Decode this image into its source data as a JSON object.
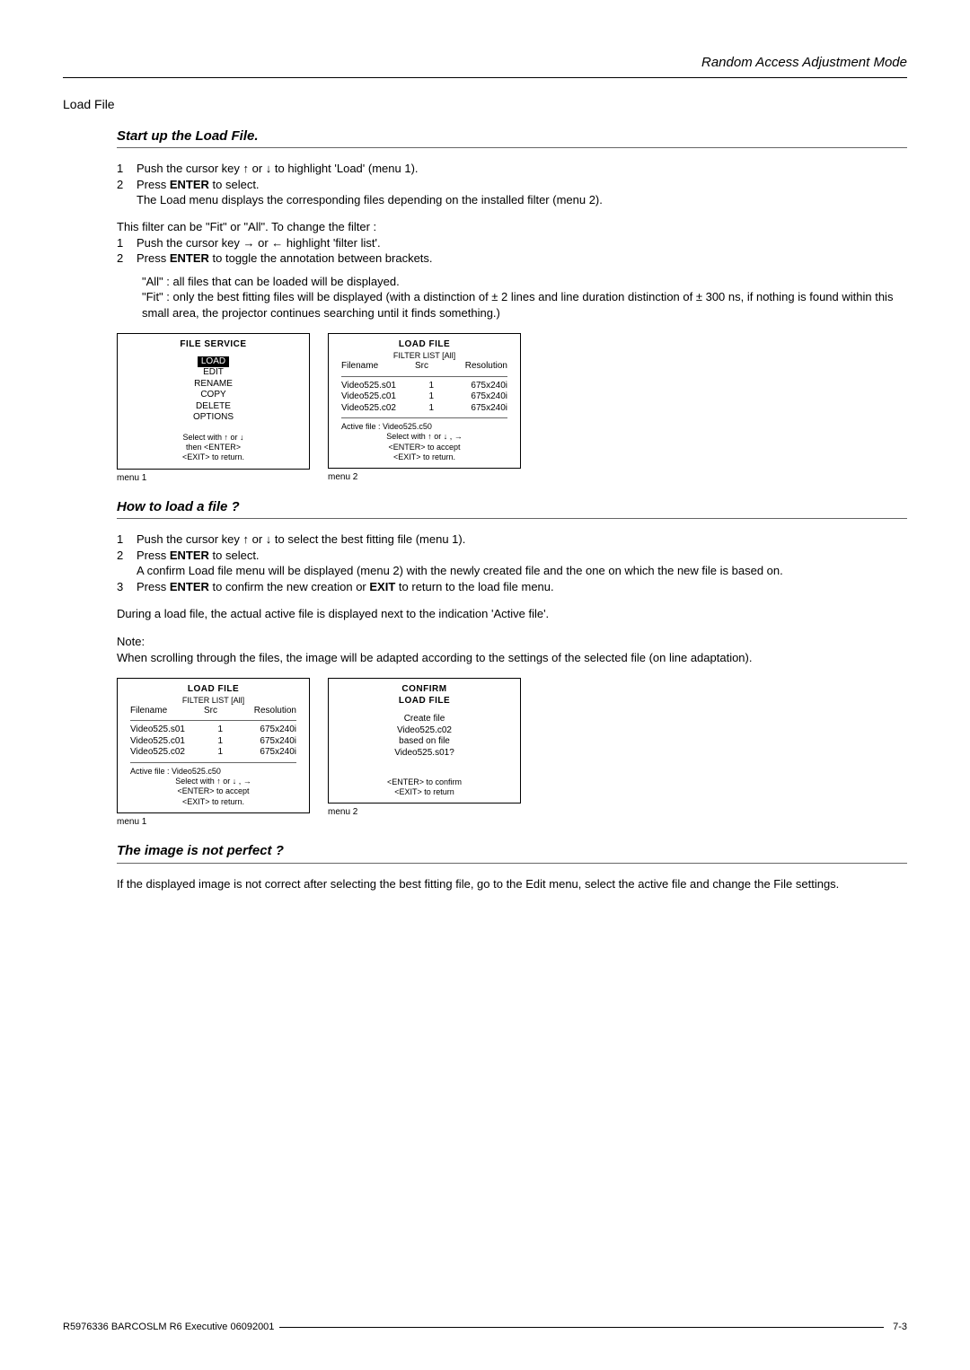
{
  "header": {
    "title": "Random Access Adjustment Mode"
  },
  "section": {
    "title": "Load File"
  },
  "startup": {
    "heading": "Start up the Load File.",
    "step1_num": "1",
    "step1": "Push the cursor key ↑ or ↓ to highlight 'Load' (menu 1).",
    "step2_num": "2",
    "step2_a": "Press ",
    "step2_b": "ENTER",
    "step2_c": " to select.",
    "step2_sub": "The Load menu displays the corresponding files depending on the installed filter (menu 2).",
    "para1": "This filter can be \"Fit\" or \"All\".  To change the filter :",
    "f1_num": "1",
    "f1": "Push the cursor key → or ← highlight 'filter list'.",
    "f2_num": "2",
    "f2_a": "Press ",
    "f2_b": "ENTER",
    "f2_c": " to toggle the annotation between brackets.",
    "all_line": "\"All\" : all files that can be loaded will be displayed.",
    "fit_line": "\"Fit\" : only the best fitting files will  be displayed (with a distinction of ± 2 lines and line duration distinction of ± 300 ns, if nothing is found within this small area, the projector continues searching until it finds something.)"
  },
  "menuA1": {
    "title": "FILE  SERVICE",
    "i0": "LOAD",
    "i1": "EDIT",
    "i2": "RENAME",
    "i3": "COPY",
    "i4": "DELETE",
    "i5": "OPTIONS",
    "s1": "Select with ↑ or ↓",
    "s2": "then  <ENTER>",
    "s3": "<EXIT>  to  return.",
    "caption": "menu 1"
  },
  "menuA2": {
    "title": "LOAD FILE",
    "filter": "FILTER  LIST  [All]",
    "h1": "Filename",
    "h2": "Src",
    "h3": "Resolution",
    "r1a": "Video525.s01",
    "r1b": "1",
    "r1c": "675x240i",
    "r2a": "Video525.c01",
    "r2b": "1",
    "r2c": "675x240i",
    "r3a": "Video525.c02",
    "r3b": "1",
    "r3c": "675x240i",
    "active": "Active  file  :  Video525.c50",
    "s1": "Select with ↑  or ↓ , →",
    "s2": "<ENTER>  to  accept",
    "s3": "<EXIT>  to  return.",
    "caption": "menu 2"
  },
  "howto": {
    "heading": "How to load a file ?",
    "s1_num": "1",
    "s1": "Push the cursor key ↑ or ↓ to select the best fitting file (menu 1).",
    "s2_num": "2",
    "s2_a": "Press ",
    "s2_b": "ENTER",
    "s2_c": " to select.",
    "s2_sub": "A confirm Load file menu will be displayed (menu 2) with the newly created file and the one on which the new file is based on.",
    "s3_num": "3",
    "s3_a": "Press ",
    "s3_b": "ENTER",
    "s3_c": " to confirm the new creation or ",
    "s3_d": "EXIT",
    "s3_e": " to return to the load file menu.",
    "para": "During a load file, the actual active file is displayed next to the indication 'Active file'.",
    "note_label": "Note:",
    "note": "When scrolling through the files, the image will be adapted according to the settings of the selected file (on line adaptation)."
  },
  "menuB1": {
    "title": "LOAD FILE",
    "filter": "FILTER  LIST  [All]",
    "h1": "Filename",
    "h2": "Src",
    "h3": "Resolution",
    "r1a": "Video525.s01",
    "r1b": "1",
    "r1c": "675x240i",
    "r2a": "Video525.c01",
    "r2b": "1",
    "r2c": "675x240i",
    "r3a": "Video525.c02",
    "r3b": "1",
    "r3c": "675x240i",
    "active": "Active  file  :  Video525.c50",
    "s1": "Select with ↑  or ↓ , →",
    "s2": "<ENTER>  to  accept",
    "s3": "<EXIT>  to  return.",
    "caption": "menu 1"
  },
  "menuB2": {
    "title1": "CONFIRM",
    "title2": "LOAD FILE",
    "l1": "Create  file",
    "l2": "Video525.c02",
    "l3": "based  on  file",
    "l4": "Video525.s01?",
    "s1": "<ENTER>  to  confirm",
    "s2": "<EXIT>  to  return",
    "caption": "menu 2"
  },
  "notperfect": {
    "heading": "The image is not perfect ?",
    "para": "If the displayed image is not correct after selecting the best fitting file, go to the Edit menu, select the active file and change the File settings."
  },
  "footer": {
    "text": "R5976336 BARCOSLM R6 Executive 06092001",
    "page": "7-3"
  }
}
